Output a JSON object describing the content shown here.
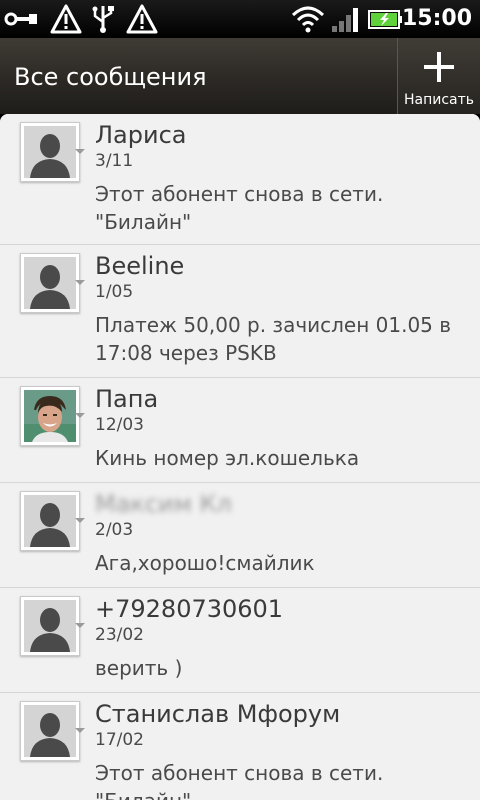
{
  "status_bar": {
    "time": "15:00",
    "icons": [
      "usb-debug-icon",
      "warning-icon",
      "usb-icon",
      "warning-icon",
      "wifi-icon",
      "signal-icon",
      "battery-charging-icon"
    ]
  },
  "header": {
    "title": "Все сообщения",
    "compose_label": "Написать",
    "compose_icon": "plus-icon"
  },
  "messages": [
    {
      "name": "Лариса",
      "date": "3/11",
      "text": "Этот абонент снова в сети. \"Билайн\"",
      "avatar": "default-contact-icon"
    },
    {
      "name": "Beeline",
      "date": "1/05",
      "text": "Платеж  50,00 р. зачислен 01.05 в 17:08 через PSKB",
      "avatar": "default-contact-icon"
    },
    {
      "name": "Папа",
      "date": "12/03",
      "text": "Кинь номер эл.кошелька",
      "avatar": "contact-photo"
    },
    {
      "name": "Максим Кл",
      "date": "2/03",
      "text": "Ага,хорошо!смайлик",
      "avatar": "default-contact-icon"
    },
    {
      "name": "+79280730601",
      "date": "23/02",
      "text": "верить )",
      "avatar": "default-contact-icon"
    },
    {
      "name": "Станислав Мфорум",
      "date": "17/02",
      "text": "Этот абонент снова в сети. \"Билайн\"",
      "avatar": "default-contact-icon"
    }
  ],
  "colors": {
    "header_bg": "#2c2925",
    "list_bg": "#f1f1f1",
    "text_primary": "#3a3a3a",
    "battery_green": "#5fd13a"
  }
}
